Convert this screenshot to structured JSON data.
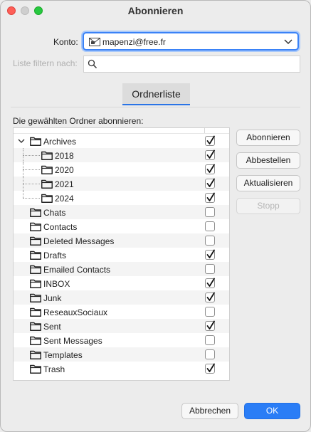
{
  "window": {
    "title": "Abonnieren"
  },
  "konto": {
    "label": "Konto:",
    "value": "mapenzi@free.fr",
    "icon": "account-mail-icon"
  },
  "filter": {
    "label": "Liste filtern nach:",
    "value": "",
    "icon": "search-icon"
  },
  "tabs": [
    {
      "label": "Ordnerliste",
      "active": true
    }
  ],
  "list": {
    "title": "Die gewählten Ordner abonnieren:",
    "folders": [
      {
        "name": "Archives",
        "level": 0,
        "expanded": true,
        "checked": true
      },
      {
        "name": "2018",
        "level": 1,
        "checked": true
      },
      {
        "name": "2020",
        "level": 1,
        "checked": true
      },
      {
        "name": "2021",
        "level": 1,
        "checked": true
      },
      {
        "name": "2024",
        "level": 1,
        "checked": true
      },
      {
        "name": "Chats",
        "level": 0,
        "checked": false
      },
      {
        "name": "Contacts",
        "level": 0,
        "checked": false
      },
      {
        "name": "Deleted Messages",
        "level": 0,
        "checked": false
      },
      {
        "name": "Drafts",
        "level": 0,
        "checked": true
      },
      {
        "name": "Emailed Contacts",
        "level": 0,
        "checked": false
      },
      {
        "name": "INBOX",
        "level": 0,
        "checked": true
      },
      {
        "name": "Junk",
        "level": 0,
        "checked": true
      },
      {
        "name": "ReseauxSociaux",
        "level": 0,
        "checked": false
      },
      {
        "name": "Sent",
        "level": 0,
        "checked": true
      },
      {
        "name": "Sent Messages",
        "level": 0,
        "checked": false
      },
      {
        "name": "Templates",
        "level": 0,
        "checked": false
      },
      {
        "name": "Trash",
        "level": 0,
        "checked": true
      }
    ]
  },
  "buttons": {
    "subscribe": "Abonnieren",
    "unsubscribe": "Abbestellen",
    "refresh": "Aktualisieren",
    "stop": "Stopp",
    "cancel": "Abbrechen",
    "ok": "OK"
  },
  "colors": {
    "accent": "#2a7df6",
    "close": "#fe5f57",
    "zoom": "#27c840"
  }
}
